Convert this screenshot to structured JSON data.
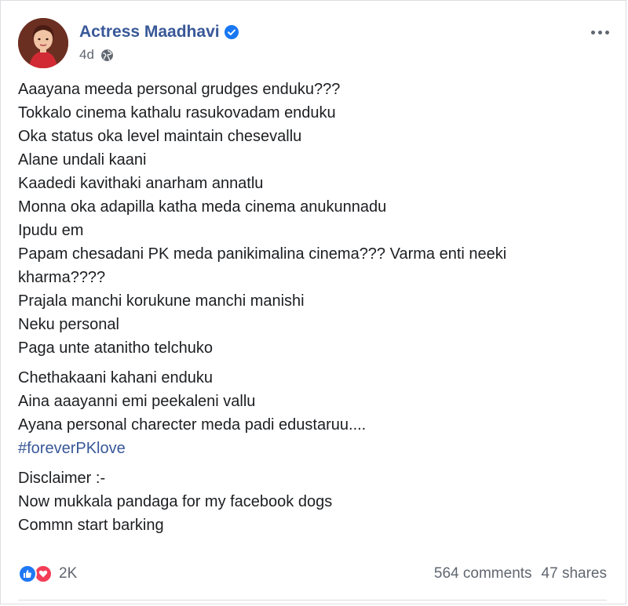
{
  "post": {
    "author": "Actress Maadhavi",
    "timestamp": "4d",
    "privacy_icon": "globe-icon",
    "verified_icon": "verified-badge-icon",
    "more_icon": "more-options-icon",
    "paragraphs": [
      [
        "Aaayana meeda personal grudges enduku???",
        "Tokkalo cinema kathalu rasukovadam enduku",
        "Oka status oka level maintain chesevallu",
        "Alane undali kaani",
        "Kaadedi kavithaki anarham annatlu",
        "Monna oka adapilla katha meda cinema anukunnadu",
        "Ipudu em",
        "Papam chesadani PK meda panikimalina cinema??? Varma enti neeki",
        "kharma????",
        "Prajala manchi korukune manchi manishi",
        "Neku personal",
        "Paga unte atanitho telchuko"
      ],
      [
        "Chethakaani kahani enduku",
        "Aina aaayanni emi peekaleni vallu",
        "Ayana personal charecter meda padi edustaruu...."
      ],
      [
        "Disclaimer :-",
        "Now mukkala pandaga for my facebook dogs",
        "Commn start barking"
      ]
    ],
    "hashtag": "#foreverPKlove"
  },
  "engagement": {
    "reaction_count": "2K",
    "comments": "564 comments",
    "shares": "47 shares",
    "reaction_icons": [
      "like-icon",
      "love-icon"
    ]
  },
  "colors": {
    "link_blue": "#385898",
    "like_blue": "#2078f4",
    "love_red": "#f33e58",
    "meta_gray": "#606770"
  }
}
